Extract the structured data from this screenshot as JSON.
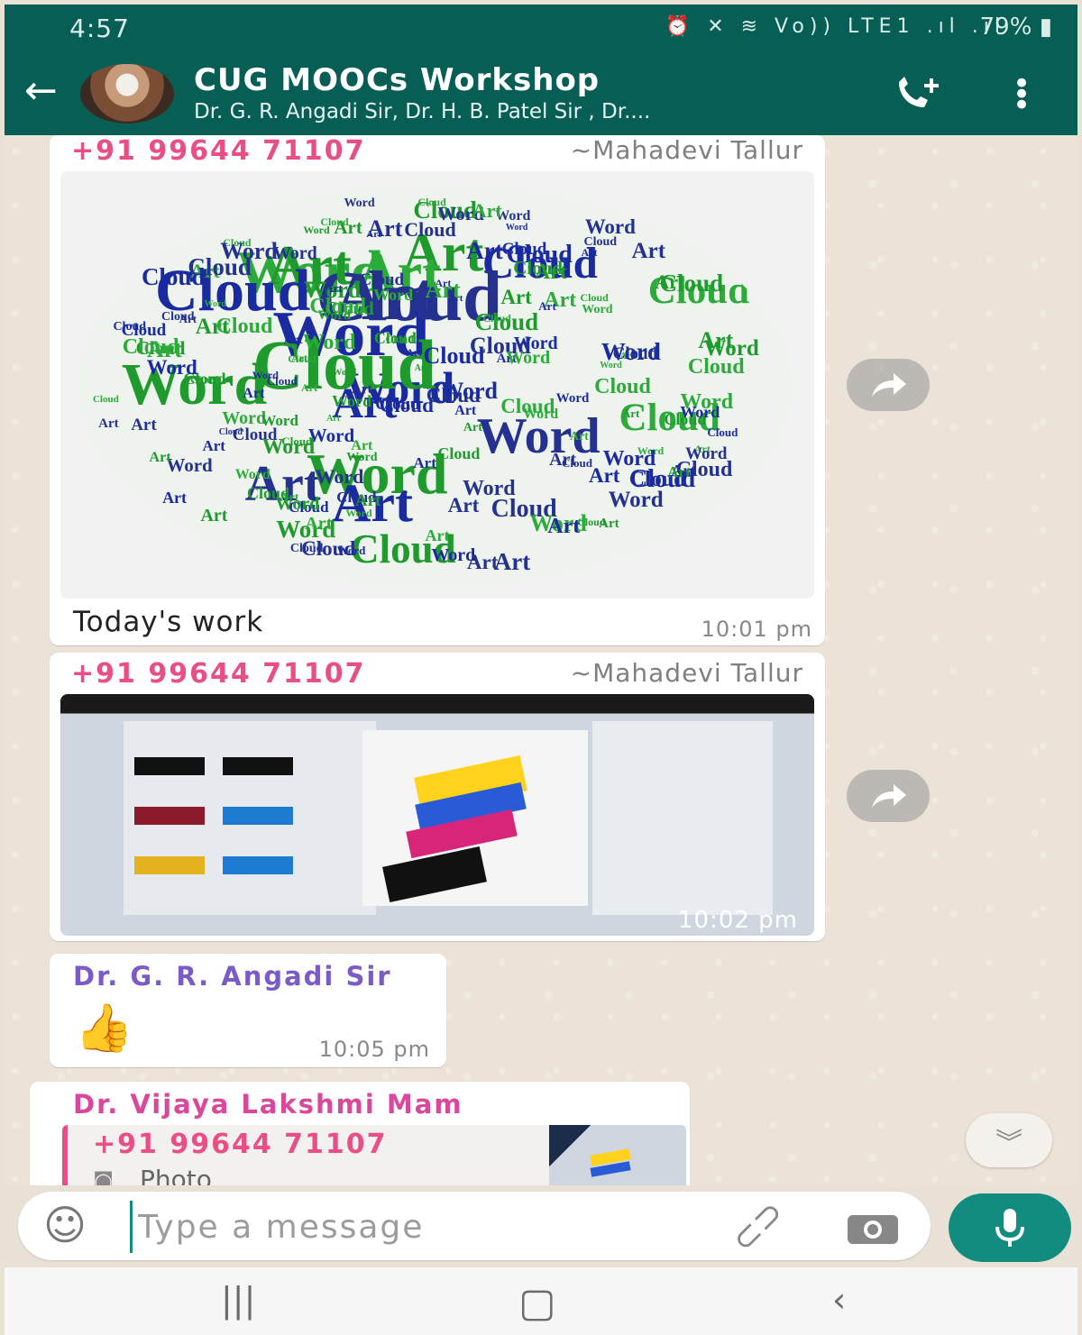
{
  "status_bar": {
    "time": "4:57",
    "indicators": "⏰ ✕ ≋ Vo)) LTE1 .ıl .ıl",
    "battery": "79%"
  },
  "header": {
    "group_name": "CUG MOOCs Workshop",
    "members": "Dr. G. R. Angadi Sir, Dr. H. B. Patel Sir , Dr...."
  },
  "messages": [
    {
      "phone": "+91 99644 71107",
      "name": "~Mahadevi Tallur",
      "caption": "Today's work",
      "time": "10:01 pm"
    },
    {
      "phone": "+91 99644 71107",
      "name": "~Mahadevi Tallur",
      "time": "10:02 pm"
    },
    {
      "author": "Dr. G. R. Angadi Sir",
      "emoji": "👍",
      "time": "10:05 pm"
    },
    {
      "author": "Dr. Vijaya Lakshmi Mam",
      "quoted_phone": "+91 99644 71107",
      "quoted_type": "Photo"
    }
  ],
  "wordcloud_words": [
    "Art",
    "Word",
    "Cloud"
  ],
  "composer": {
    "placeholder": "Type a message"
  },
  "icons": {
    "back": "back-arrow-icon",
    "call": "add-call-icon",
    "menu": "more-vert-icon",
    "forward": "forward-icon",
    "emoji": "emoji-icon",
    "attach": "attach-icon",
    "camera": "camera-icon",
    "mic": "mic-icon",
    "scroll": "scroll-down-icon"
  },
  "colors": {
    "header": "#075e54",
    "accent": "#128c7e",
    "phone": "#e94f86",
    "author_1": "#7a5bc7",
    "author_2": "#d9489b"
  }
}
